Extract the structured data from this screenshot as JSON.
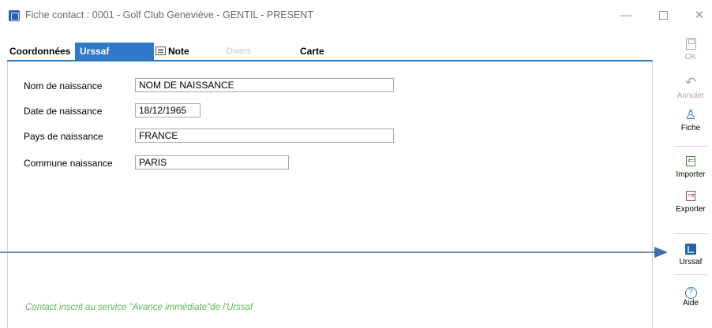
{
  "window": {
    "title": "Fiche contact : 0001 - Golf Club Geneviève - GENTIL - PRESENT",
    "min_glyph": "—",
    "close_glyph": "✕"
  },
  "tabs": [
    {
      "label": "Coordonnées",
      "active": false,
      "enabled": true
    },
    {
      "label": "Urssaf",
      "active": true,
      "enabled": true
    },
    {
      "label": "Note",
      "active": false,
      "enabled": true,
      "icon": "note-icon"
    },
    {
      "label": "Divers",
      "active": false,
      "enabled": false
    },
    {
      "label": "Carte",
      "active": false,
      "enabled": true
    }
  ],
  "form": {
    "nom_naissance": {
      "label": "Nom de naissance",
      "value": "NOM DE NAISSANCE"
    },
    "date_naissance": {
      "label": "Date de naissance",
      "value": "18/12/1965"
    },
    "pays_naissance": {
      "label": "Pays de naissance",
      "value": "FRANCE"
    },
    "commune_naissance": {
      "label": "Commune naissance",
      "value": "PARIS"
    }
  },
  "footer_note": "Contact inscrit au service \"Avance immédiate\"de l'Urssaf",
  "toolbar": {
    "ok": {
      "label": "OK",
      "icon": "save-icon",
      "enabled": false
    },
    "annuler": {
      "label": "Annuler",
      "icon": "undo-icon",
      "enabled": false,
      "glyph": "↶"
    },
    "fiche": {
      "label": "Fiche",
      "icon": "person-icon",
      "enabled": true,
      "glyph": "♙"
    },
    "importer": {
      "label": "Importer",
      "icon": "import-icon",
      "enabled": true
    },
    "exporter": {
      "label": "Exporter",
      "icon": "export-icon",
      "enabled": true
    },
    "urssaf": {
      "label": "Urssaf",
      "icon": "urssaf-icon",
      "enabled": true
    },
    "aide": {
      "label": "Aide",
      "icon": "help-icon",
      "enabled": true,
      "glyph": "?"
    }
  },
  "colors": {
    "accent": "#2f79c7",
    "arrow": "#3f6fa6",
    "note_text": "#5cb85c",
    "disabled_text": "#a8a8a8"
  }
}
